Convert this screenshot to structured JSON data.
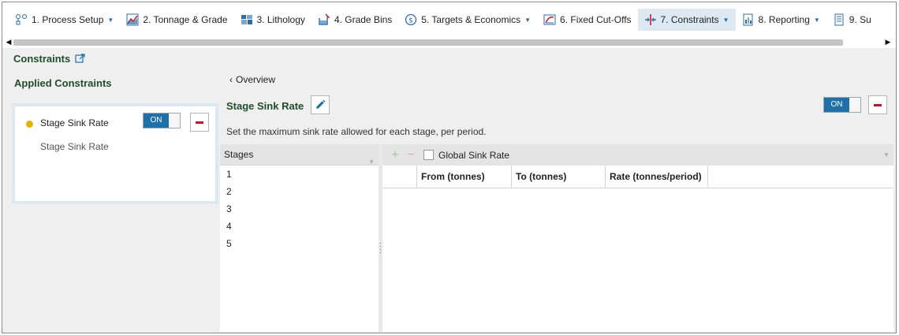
{
  "tabs": [
    {
      "label": "1. Process Setup",
      "icon": "process-setup-icon",
      "caret": true,
      "active": false
    },
    {
      "label": "2. Tonnage & Grade",
      "icon": "chart-icon",
      "caret": false,
      "active": false
    },
    {
      "label": "3. Lithology",
      "icon": "lithology-icon",
      "caret": false,
      "active": false
    },
    {
      "label": "4. Grade Bins",
      "icon": "grade-bins-icon",
      "caret": false,
      "active": false
    },
    {
      "label": "5. Targets & Economics",
      "icon": "dollar-icon",
      "caret": true,
      "active": false
    },
    {
      "label": "6. Fixed Cut-Offs",
      "icon": "cutoffs-icon",
      "caret": false,
      "active": false
    },
    {
      "label": "7. Constraints",
      "icon": "constraints-icon",
      "caret": true,
      "active": true
    },
    {
      "label": "8. Reporting",
      "icon": "reporting-icon",
      "caret": true,
      "active": false
    },
    {
      "label": "9. Su",
      "icon": "summary-icon",
      "caret": false,
      "active": false
    }
  ],
  "header": {
    "title": "Constraints"
  },
  "left": {
    "title": "Applied Constraints",
    "card": {
      "name": "Stage Sink Rate",
      "subtitle": "Stage Sink Rate",
      "toggle": "ON",
      "status_color": "#e8b000"
    }
  },
  "right": {
    "back_label": "Overview",
    "title": "Stage Sink Rate",
    "toggle": "ON",
    "description": "Set the maximum sink rate allowed for each stage, per period.",
    "stages_header": "Stages",
    "stages": [
      "1",
      "2",
      "3",
      "4",
      "5"
    ],
    "table": {
      "checkbox_label": "Global Sink Rate",
      "columns": [
        "",
        "From (tonnes)",
        "To (tonnes)",
        "Rate (tonnes/period)"
      ]
    }
  },
  "colors": {
    "accent": "#1f6fa8",
    "title": "#1f4e2a",
    "danger": "#c8102e",
    "active_tab": "#dce9f3"
  }
}
